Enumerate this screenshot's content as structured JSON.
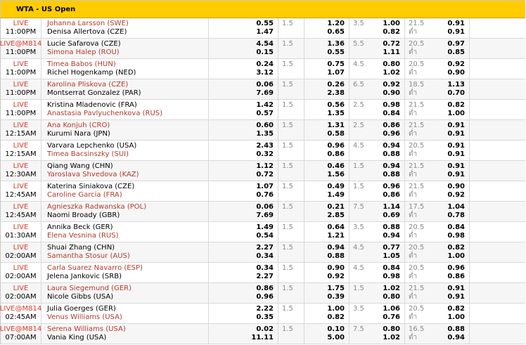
{
  "header": {
    "title": "WTA - US Open"
  },
  "matches": [
    {
      "live": "LIVE",
      "time": "11:00PM",
      "p1": "Johanna Larsson (SWE)",
      "p2": "Denisa Allertova (CZE)",
      "fav": 1,
      "ml1": "0.55",
      "ml2": "1.47",
      "hcap": "1.5",
      "h1": "1.20",
      "h2": "0.65",
      "ou": "3.5",
      "ou1": "1.00",
      "ou2": "0.82",
      "ou2l1": "21.5",
      "ou2l2": "ต่ำ",
      "ou2o1": "0.91",
      "ou2o2": "0.91"
    },
    {
      "live": "LIVE@M814",
      "time": "11:00PM",
      "p1": "Lucie Safarova (CZE)",
      "p2": "Simona Halep (ROU)",
      "fav": 2,
      "ml1": "4.54",
      "ml2": "0.15",
      "hcap": "1.5",
      "h1": "1.36",
      "h2": "0.55",
      "ou": "5.5",
      "ou1": "0.72",
      "ou2": "1.11",
      "ou2l1": "20.5",
      "ou2l2": "ต่ำ",
      "ou2o1": "0.97",
      "ou2o2": "0.85"
    },
    {
      "live": "LIVE",
      "time": "11:00PM",
      "p1": "Timea Babos (HUN)",
      "p2": "Richel Hogenkamp (NED)",
      "fav": 1,
      "ml1": "0.24",
      "ml2": "3.12",
      "hcap": "1.5",
      "h1": "0.75",
      "h2": "1.07",
      "ou": "4.5",
      "ou1": "0.80",
      "ou2": "1.02",
      "ou2l1": "20.5",
      "ou2l2": "ต่ำ",
      "ou2o1": "0.92",
      "ou2o2": "0.90"
    },
    {
      "live": "LIVE",
      "time": "11:00PM",
      "p1": "Karolina Pliskova (CZE)",
      "p2": "Montserrat Gonzalez (PAR)",
      "fav": 1,
      "ml1": "0.06",
      "ml2": "7.69",
      "hcap": "1.5",
      "h1": "0.26",
      "h2": "2.38",
      "ou": "6.5",
      "ou1": "0.92",
      "ou2": "0.90",
      "ou2l1": "18.5",
      "ou2l2": "ต่ำ",
      "ou2o1": "1.13",
      "ou2o2": "0.70"
    },
    {
      "live": "LIVE",
      "time": "11:00PM",
      "p1": "Kristina Mladenovic (FRA)",
      "p2": "Anastasia Pavlyuchenkova (RUS)",
      "fav": 2,
      "ml1": "1.42",
      "ml2": "0.57",
      "hcap": "1.5",
      "h1": "0.56",
      "h2": "1.35",
      "ou": "2.5",
      "ou1": "0.98",
      "ou2": "0.84",
      "ou2l1": "21.5",
      "ou2l2": "ต่ำ",
      "ou2o1": "0.82",
      "ou2o2": "1.00"
    },
    {
      "live": "LIVE",
      "time": "12:15AM",
      "p1": "Ana Konjuh (CRO)",
      "p2": "Kurumi Nara (JPN)",
      "fav": 1,
      "ml1": "0.60",
      "ml2": "1.35",
      "hcap": "1.5",
      "h1": "1.31",
      "h2": "0.58",
      "ou": "2.5",
      "ou1": "0.86",
      "ou2": "0.96",
      "ou2l1": "21.5",
      "ou2l2": "ต่ำ",
      "ou2o1": "0.91",
      "ou2o2": "0.91"
    },
    {
      "live": "LIVE",
      "time": "12:15AM",
      "p1": "Varvara Lepchenko (USA)",
      "p2": "Timea Bacsinszky (SUI)",
      "fav": 2,
      "ml1": "2.43",
      "ml2": "0.32",
      "hcap": "1.5",
      "h1": "0.96",
      "h2": "0.86",
      "ou": "4.5",
      "ou1": "0.94",
      "ou2": "0.88",
      "ou2l1": "20.5",
      "ou2l2": "ต่ำ",
      "ou2o1": "0.91",
      "ou2o2": "0.91"
    },
    {
      "live": "LIVE",
      "time": "12:30AM",
      "p1": "Qiang Wang (CHN)",
      "p2": "Yaroslava Shvedova (KAZ)",
      "fav": 2,
      "ml1": "1.12",
      "ml2": "0.72",
      "hcap": "1.5",
      "h1": "0.46",
      "h2": "1.56",
      "ou": "1.5",
      "ou1": "0.94",
      "ou2": "0.88",
      "ou2l1": "21.5",
      "ou2l2": "ต่ำ",
      "ou2o1": "0.91",
      "ou2o2": "0.91"
    },
    {
      "live": "LIVE",
      "time": "12:45AM",
      "p1": "Katerina Siniakova (CZE)",
      "p2": "Caroline Garcia (FRA)",
      "fav": 2,
      "ml1": "1.07",
      "ml2": "0.76",
      "hcap": "1.5",
      "h1": "0.49",
      "h2": "1.49",
      "ou": "1.5",
      "ou1": "0.96",
      "ou2": "0.86",
      "ou2l1": "21.5",
      "ou2l2": "ต่ำ",
      "ou2o1": "0.90",
      "ou2o2": "0.92"
    },
    {
      "live": "LIVE",
      "time": "12:45AM",
      "p1": "Agnieszka Radwanska (POL)",
      "p2": "Naomi Broady (GBR)",
      "fav": 1,
      "ml1": "0.06",
      "ml2": "7.69",
      "hcap": "1.5",
      "h1": "0.21",
      "h2": "2.85",
      "ou": "7.5",
      "ou1": "1.14",
      "ou2": "0.69",
      "ou2l1": "17.5",
      "ou2l2": "ต่ำ",
      "ou2o1": "1.04",
      "ou2o2": "0.78"
    },
    {
      "live": "LIVE",
      "time": "01:30AM",
      "p1": "Annika Beck (GER)",
      "p2": "Elena Vesnina (RUS)",
      "fav": 2,
      "ml1": "1.49",
      "ml2": "0.54",
      "hcap": "1.5",
      "h1": "0.64",
      "h2": "1.21",
      "ou": "3.5",
      "ou1": "0.88",
      "ou2": "0.94",
      "ou2l1": "20.5",
      "ou2l2": "ต่ำ",
      "ou2o1": "0.84",
      "ou2o2": "0.98"
    },
    {
      "live": "LIVE",
      "time": "02:00AM",
      "p1": "Shuai Zhang (CHN)",
      "p2": "Samantha Stosur (AUS)",
      "fav": 2,
      "ml1": "2.27",
      "ml2": "0.34",
      "hcap": "1.5",
      "h1": "0.94",
      "h2": "0.88",
      "ou": "4.5",
      "ou1": "0.77",
      "ou2": "1.05",
      "ou2l1": "20.5",
      "ou2l2": "ต่ำ",
      "ou2o1": "0.82",
      "ou2o2": "1.00"
    },
    {
      "live": "LIVE",
      "time": "02:00AM",
      "p1": "Carla Suarez Navarro (ESP)",
      "p2": "Jelena Jankovic (SRB)",
      "fav": 1,
      "ml1": "0.34",
      "ml2": "2.27",
      "hcap": "1.5",
      "h1": "0.90",
      "h2": "0.92",
      "ou": "4.5",
      "ou1": "0.84",
      "ou2": "0.98",
      "ou2l1": "20.5",
      "ou2l2": "ต่ำ",
      "ou2o1": "0.96",
      "ou2o2": "0.86"
    },
    {
      "live": "LIVE",
      "time": "02:00AM",
      "p1": "Laura Siegemund (GER)",
      "p2": "Nicole Gibbs (USA)",
      "fav": 1,
      "ml1": "0.86",
      "ml2": "0.96",
      "hcap": "1.5",
      "h1": "1.75",
      "h2": "0.39",
      "ou": "1.5",
      "ou1": "1.02",
      "ou2": "0.80",
      "ou2l1": "21.5",
      "ou2l2": "ต่ำ",
      "ou2o1": "0.91",
      "ou2o2": "0.91"
    },
    {
      "live": "LIVE@M814",
      "time": "02:45AM",
      "p1": "Julia Goerges (GER)",
      "p2": "Venus Williams (USA)",
      "fav": 2,
      "ml1": "2.22",
      "ml2": "0.35",
      "hcap": "1.5",
      "h1": "1.00",
      "h2": "0.82",
      "ou": "3.5",
      "ou1": "1.06",
      "ou2": "0.76",
      "ou2l1": "20.5",
      "ou2l2": "ต่ำ",
      "ou2o1": "0.82",
      "ou2o2": "1.00"
    },
    {
      "live": "LIVE@M814",
      "time": "07:00AM",
      "p1": "Serena Williams (USA)",
      "p2": "Vania King (USA)",
      "fav": 1,
      "ml1": "0.02",
      "ml2": "11.11",
      "hcap": "1.5",
      "h1": "0.10",
      "h2": "5.00",
      "ou": "7.5",
      "ou1": "0.80",
      "ou2": "1.02",
      "ou2l1": "16.5",
      "ou2l2": "ต่ำ",
      "ou2o1": "0.88",
      "ou2o2": "0.94"
    }
  ]
}
